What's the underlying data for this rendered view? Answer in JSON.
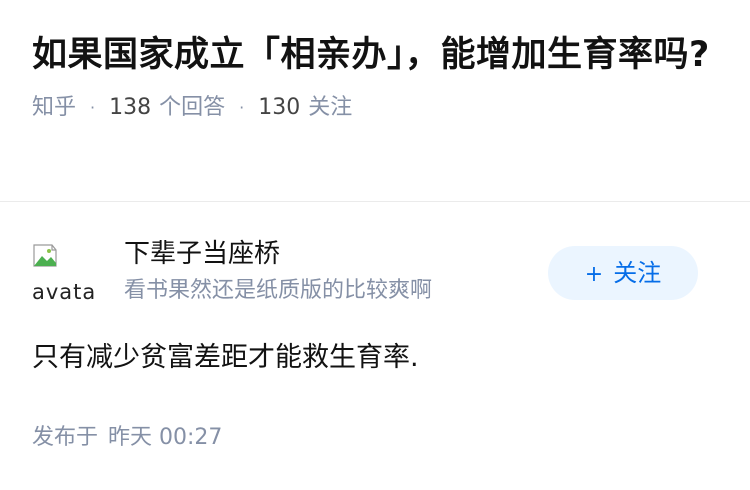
{
  "question": {
    "title": "如果国家成立「相亲办」，能增加生育率吗?",
    "source": "知乎",
    "answer_count": "138",
    "answer_label": "个回答",
    "follow_count": "130",
    "follow_label": "关注"
  },
  "author": {
    "avatar_alt": "avatar",
    "name": "下辈子当座桥",
    "bio": "看书果然还是纸质版的比较爽啊",
    "follow_button_label": "关注",
    "follow_button_icon": "+"
  },
  "answer": {
    "content": "只有减少贫富差距才能救生育率.",
    "publish_label": "发布于",
    "publish_time": "昨天 00:27"
  },
  "colors": {
    "meta_gray": "#8590a6",
    "follow_blue": "#056de8",
    "follow_bg": "#ebf5ff"
  }
}
